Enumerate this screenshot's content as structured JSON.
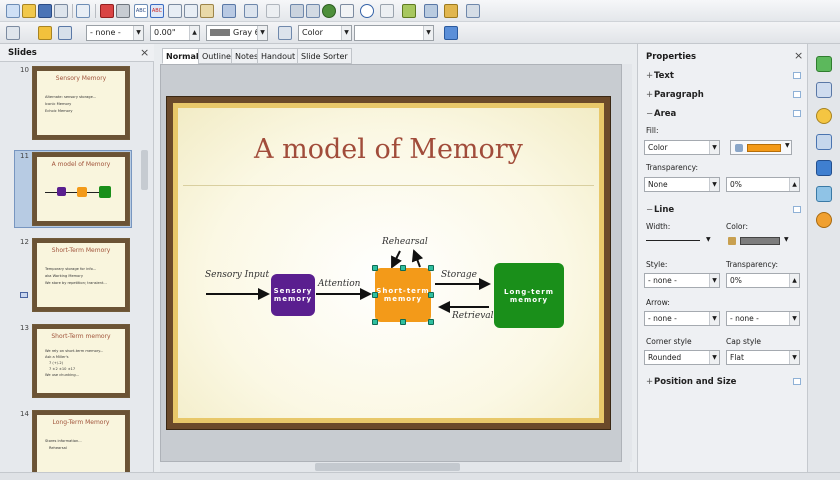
{
  "toolbar2": {
    "line_style": "- none -",
    "line_width": "0.00\"",
    "line_color": "Gray 6",
    "area_style": "Color",
    "area_value": ""
  },
  "slides_panel": {
    "title": "Slides",
    "close": "×",
    "thumbnails": [
      {
        "number": "10",
        "title": "Sensory Memory",
        "bullets": [
          "Alternate: sensory storage...",
          "Iconic Memory",
          "Echoic Memory"
        ]
      },
      {
        "number": "11",
        "title": "A model of Memory",
        "bullets": []
      },
      {
        "number": "12",
        "title": "Short-Term Memory",
        "bullets": [
          "Temporary storage for info...",
          "aka Working Memory",
          "We store by repetition; transient..."
        ]
      },
      {
        "number": "13",
        "title": "Short-Term memory",
        "bullets": [
          "We rely on short-term memory...",
          "Ask a Miller's",
          "7 (+/-2)",
          "7 ±2 ±10 ±17",
          "We use chunking..."
        ]
      },
      {
        "number": "14",
        "title": "Long-Term Memory",
        "bullets": [
          "Stores information...",
          "Rehearsal"
        ]
      }
    ]
  },
  "view_tabs": [
    "Normal",
    "Outline",
    "Notes",
    "Handout",
    "Slide Sorter"
  ],
  "slide": {
    "title": "A model of Memory",
    "boxes": {
      "sensory": "Sensory memory",
      "short_term": "Short-term memory",
      "long_term": "Long-term memory"
    },
    "labels": {
      "sensory_input": "Sensory Input",
      "attention": "Attention",
      "rehearsal": "Rehearsal",
      "storage": "Storage",
      "retrieval": "Retrieval"
    }
  },
  "properties": {
    "title": "Properties",
    "close": "×",
    "sections": {
      "text": "Text",
      "paragraph": "Paragraph",
      "area": "Area",
      "line": "Line",
      "position": "Position and Size"
    },
    "area": {
      "fill_label": "Fill:",
      "fill_value": "Color",
      "transparency_label": "Transparency:",
      "transparency_mode": "None",
      "transparency_value": "0%"
    },
    "line": {
      "width_label": "Width:",
      "color_label": "Color:",
      "style_label": "Style:",
      "style_value": "- none -",
      "transparency_label": "Transparency:",
      "transparency_value": "0%",
      "arrow_label": "Arrow:",
      "arrow_start": "- none -",
      "arrow_end": "- none -",
      "corner_label": "Corner style",
      "corner_value": "Rounded",
      "cap_label": "Cap style",
      "cap_value": "Flat"
    }
  },
  "colors": {
    "sensory": "#5a1f8f",
    "short_term": "#f39a19",
    "long_term": "#1a8f1a",
    "title": "#a14c3a",
    "selection": "#2fbf9f"
  }
}
